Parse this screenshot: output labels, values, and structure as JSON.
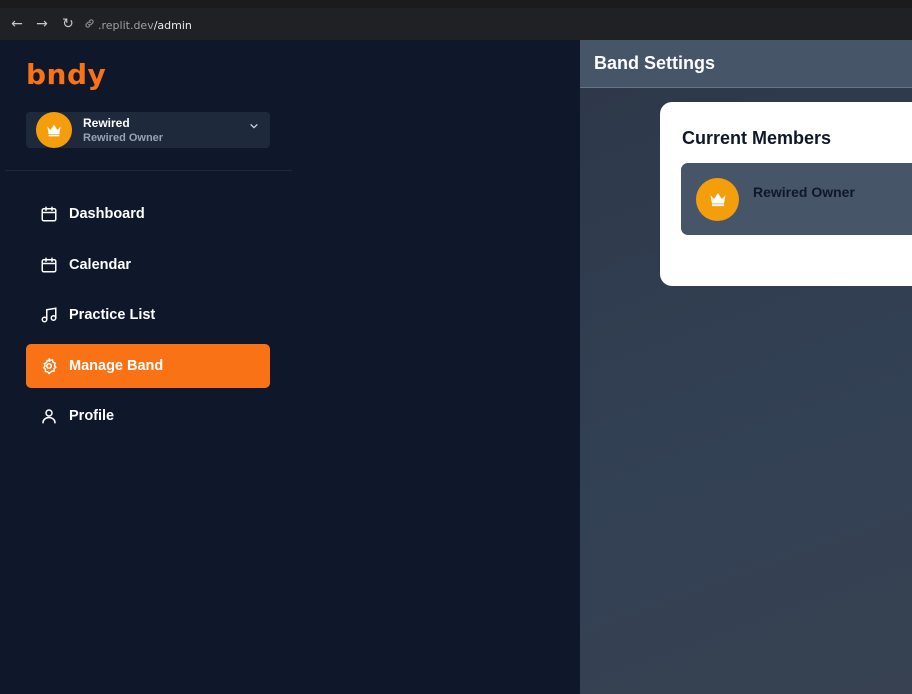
{
  "browser": {
    "back_glyph": "←",
    "forward_glyph": "→",
    "reload_glyph": "↻",
    "url_host": ".replit.dev",
    "url_path": "/admin"
  },
  "sidebar": {
    "logo_text": "bndy",
    "band_switcher": {
      "name": "Rewired",
      "role": "Rewired Owner",
      "avatar_icon": "crown-icon"
    },
    "items": [
      {
        "label": "Dashboard",
        "icon": "calendar-icon",
        "active": false
      },
      {
        "label": "Calendar",
        "icon": "calendar-icon",
        "active": false
      },
      {
        "label": "Practice List",
        "icon": "music-note-icon",
        "active": false
      },
      {
        "label": "Manage Band",
        "icon": "gear-icon",
        "active": true
      },
      {
        "label": "Profile",
        "icon": "user-icon",
        "active": false
      }
    ]
  },
  "main": {
    "title": "Band Settings",
    "members_card": {
      "title": "Current Members",
      "members": [
        {
          "name": "Rewired Owner",
          "avatar_icon": "crown-icon"
        }
      ]
    }
  },
  "colors": {
    "accent": "#f97316",
    "avatar": "#f59e0b",
    "sidebar_bg": "#0f172a"
  }
}
